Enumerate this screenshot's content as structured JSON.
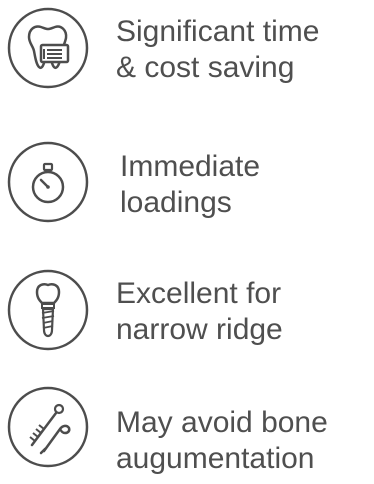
{
  "features": [
    {
      "icon": "tooth-with-ticket-icon",
      "line1": "Significant time",
      "line2": "& cost saving"
    },
    {
      "icon": "stopwatch-icon",
      "line1": "Immediate",
      "line2": "loadings"
    },
    {
      "icon": "dental-implant-icon",
      "line1": "Excellent for",
      "line2": "narrow ridge"
    },
    {
      "icon": "dental-tools-icon",
      "line1": "May avoid bone",
      "line2": "augumentation"
    }
  ],
  "colors": {
    "text": "#4f4f4f",
    "icon_stroke": "#4d4d4d",
    "background": "#ffffff"
  }
}
